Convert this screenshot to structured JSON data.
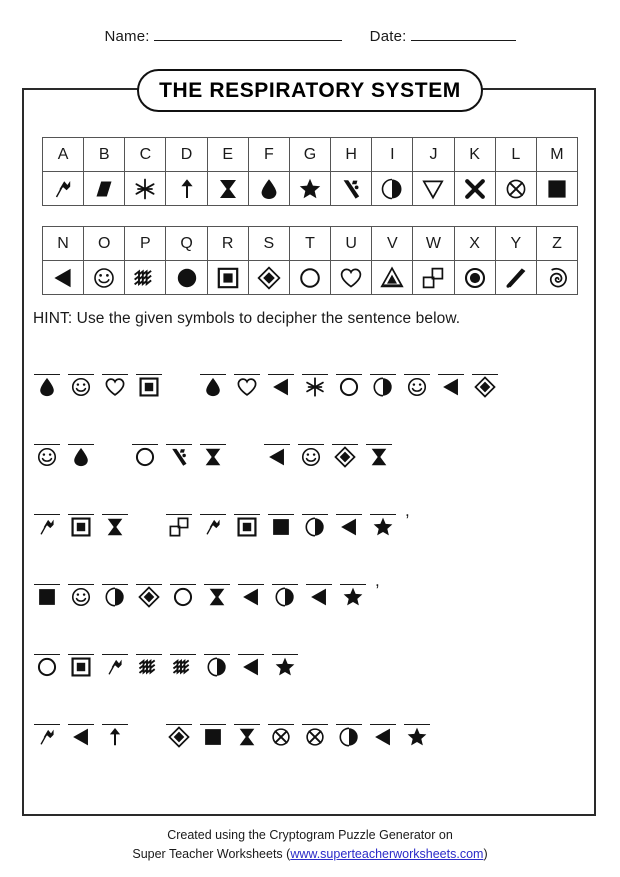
{
  "header": {
    "name_label": "Name:",
    "date_label": "Date:"
  },
  "title": "THE RESPIRATORY SYSTEM",
  "key": {
    "row1_letters": [
      "A",
      "B",
      "C",
      "D",
      "E",
      "F",
      "G",
      "H",
      "I",
      "J",
      "K",
      "L",
      "M"
    ],
    "row1_symbols": [
      "flag-icon",
      "parallelogram-icon",
      "asterisk-icon",
      "up-arrow-icon",
      "hourglass-icon",
      "teardrop-icon",
      "star-icon",
      "slash-marks-icon",
      "half-circle-icon",
      "down-triangle-icon",
      "x-cross-icon",
      "circle-x-icon",
      "filled-square-icon"
    ],
    "row2_letters": [
      "N",
      "O",
      "P",
      "Q",
      "R",
      "S",
      "T",
      "U",
      "V",
      "W",
      "X",
      "Y",
      "Z"
    ],
    "row2_symbols": [
      "left-triangle-icon",
      "smiley-icon",
      "waves-icon",
      "filled-circle-icon",
      "square-in-square-icon",
      "diamond-in-diamond-icon",
      "circle-outline-icon",
      "heart-icon",
      "triangle-in-triangle-icon",
      "offset-squares-icon",
      "circle-dot-icon",
      "diagonal-rays-icon",
      "spiral-icon"
    ]
  },
  "hint": "HINT: Use the given symbols to decipher the sentence below.",
  "puzzle": {
    "lines": [
      {
        "words": [
          {
            "letters": "FOUR",
            "punct": ""
          },
          {
            "letters": "FUNCTIONS",
            "punct": ""
          }
        ]
      },
      {
        "words": [
          {
            "letters": "OF",
            "punct": ""
          },
          {
            "letters": "THE",
            "punct": ""
          },
          {
            "letters": "NOSE",
            "punct": ""
          }
        ]
      },
      {
        "words": [
          {
            "letters": "ARE",
            "punct": ""
          },
          {
            "letters": "WARMING",
            "punct": ","
          }
        ]
      },
      {
        "words": [
          {
            "letters": "MOISTENING",
            "punct": ","
          }
        ]
      },
      {
        "words": [
          {
            "letters": "TRAPPING",
            "punct": ""
          }
        ]
      },
      {
        "words": [
          {
            "letters": "AND",
            "punct": ""
          },
          {
            "letters": "SMELLING",
            "punct": ""
          }
        ]
      }
    ]
  },
  "footer": {
    "line1": "Created using the Cryptogram Puzzle Generator on",
    "line2_pre": "Super Teacher Worksheets (",
    "url": "www.superteacherworksheets.com",
    "line2_post": ")"
  },
  "colors": {
    "ink": "#1a1a1a",
    "border": "#2a2a2a",
    "link": "#2b2bc8"
  }
}
